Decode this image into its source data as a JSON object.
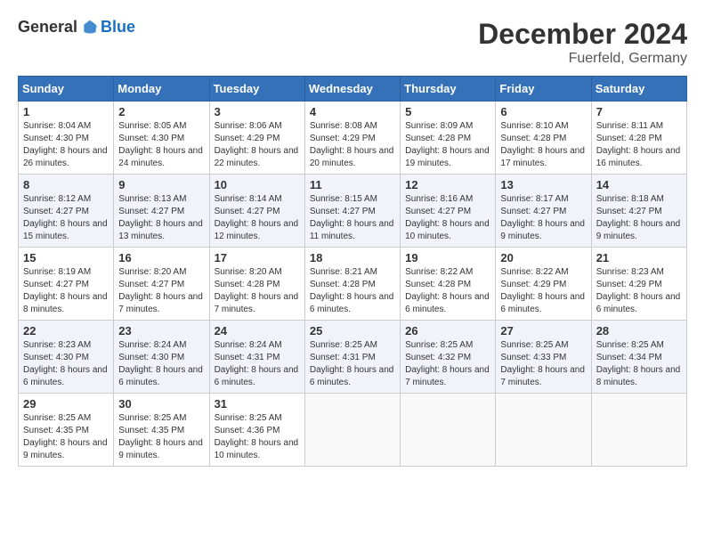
{
  "logo": {
    "general": "General",
    "blue": "Blue"
  },
  "title": "December 2024",
  "subtitle": "Fuerfeld, Germany",
  "days_of_week": [
    "Sunday",
    "Monday",
    "Tuesday",
    "Wednesday",
    "Thursday",
    "Friday",
    "Saturday"
  ],
  "weeks": [
    [
      {
        "day": "1",
        "sunrise": "8:04 AM",
        "sunset": "4:30 PM",
        "daylight": "8 hours and 26 minutes."
      },
      {
        "day": "2",
        "sunrise": "8:05 AM",
        "sunset": "4:30 PM",
        "daylight": "8 hours and 24 minutes."
      },
      {
        "day": "3",
        "sunrise": "8:06 AM",
        "sunset": "4:29 PM",
        "daylight": "8 hours and 22 minutes."
      },
      {
        "day": "4",
        "sunrise": "8:08 AM",
        "sunset": "4:29 PM",
        "daylight": "8 hours and 20 minutes."
      },
      {
        "day": "5",
        "sunrise": "8:09 AM",
        "sunset": "4:28 PM",
        "daylight": "8 hours and 19 minutes."
      },
      {
        "day": "6",
        "sunrise": "8:10 AM",
        "sunset": "4:28 PM",
        "daylight": "8 hours and 17 minutes."
      },
      {
        "day": "7",
        "sunrise": "8:11 AM",
        "sunset": "4:28 PM",
        "daylight": "8 hours and 16 minutes."
      }
    ],
    [
      {
        "day": "8",
        "sunrise": "8:12 AM",
        "sunset": "4:27 PM",
        "daylight": "8 hours and 15 minutes."
      },
      {
        "day": "9",
        "sunrise": "8:13 AM",
        "sunset": "4:27 PM",
        "daylight": "8 hours and 13 minutes."
      },
      {
        "day": "10",
        "sunrise": "8:14 AM",
        "sunset": "4:27 PM",
        "daylight": "8 hours and 12 minutes."
      },
      {
        "day": "11",
        "sunrise": "8:15 AM",
        "sunset": "4:27 PM",
        "daylight": "8 hours and 11 minutes."
      },
      {
        "day": "12",
        "sunrise": "8:16 AM",
        "sunset": "4:27 PM",
        "daylight": "8 hours and 10 minutes."
      },
      {
        "day": "13",
        "sunrise": "8:17 AM",
        "sunset": "4:27 PM",
        "daylight": "8 hours and 9 minutes."
      },
      {
        "day": "14",
        "sunrise": "8:18 AM",
        "sunset": "4:27 PM",
        "daylight": "8 hours and 9 minutes."
      }
    ],
    [
      {
        "day": "15",
        "sunrise": "8:19 AM",
        "sunset": "4:27 PM",
        "daylight": "8 hours and 8 minutes."
      },
      {
        "day": "16",
        "sunrise": "8:20 AM",
        "sunset": "4:27 PM",
        "daylight": "8 hours and 7 minutes."
      },
      {
        "day": "17",
        "sunrise": "8:20 AM",
        "sunset": "4:28 PM",
        "daylight": "8 hours and 7 minutes."
      },
      {
        "day": "18",
        "sunrise": "8:21 AM",
        "sunset": "4:28 PM",
        "daylight": "8 hours and 6 minutes."
      },
      {
        "day": "19",
        "sunrise": "8:22 AM",
        "sunset": "4:28 PM",
        "daylight": "8 hours and 6 minutes."
      },
      {
        "day": "20",
        "sunrise": "8:22 AM",
        "sunset": "4:29 PM",
        "daylight": "8 hours and 6 minutes."
      },
      {
        "day": "21",
        "sunrise": "8:23 AM",
        "sunset": "4:29 PM",
        "daylight": "8 hours and 6 minutes."
      }
    ],
    [
      {
        "day": "22",
        "sunrise": "8:23 AM",
        "sunset": "4:30 PM",
        "daylight": "8 hours and 6 minutes."
      },
      {
        "day": "23",
        "sunrise": "8:24 AM",
        "sunset": "4:30 PM",
        "daylight": "8 hours and 6 minutes."
      },
      {
        "day": "24",
        "sunrise": "8:24 AM",
        "sunset": "4:31 PM",
        "daylight": "8 hours and 6 minutes."
      },
      {
        "day": "25",
        "sunrise": "8:25 AM",
        "sunset": "4:31 PM",
        "daylight": "8 hours and 6 minutes."
      },
      {
        "day": "26",
        "sunrise": "8:25 AM",
        "sunset": "4:32 PM",
        "daylight": "8 hours and 7 minutes."
      },
      {
        "day": "27",
        "sunrise": "8:25 AM",
        "sunset": "4:33 PM",
        "daylight": "8 hours and 7 minutes."
      },
      {
        "day": "28",
        "sunrise": "8:25 AM",
        "sunset": "4:34 PM",
        "daylight": "8 hours and 8 minutes."
      }
    ],
    [
      {
        "day": "29",
        "sunrise": "8:25 AM",
        "sunset": "4:35 PM",
        "daylight": "8 hours and 9 minutes."
      },
      {
        "day": "30",
        "sunrise": "8:25 AM",
        "sunset": "4:35 PM",
        "daylight": "8 hours and 9 minutes."
      },
      {
        "day": "31",
        "sunrise": "8:25 AM",
        "sunset": "4:36 PM",
        "daylight": "8 hours and 10 minutes."
      },
      null,
      null,
      null,
      null
    ]
  ],
  "labels": {
    "sunrise": "Sunrise:",
    "sunset": "Sunset:",
    "daylight": "Daylight:"
  }
}
